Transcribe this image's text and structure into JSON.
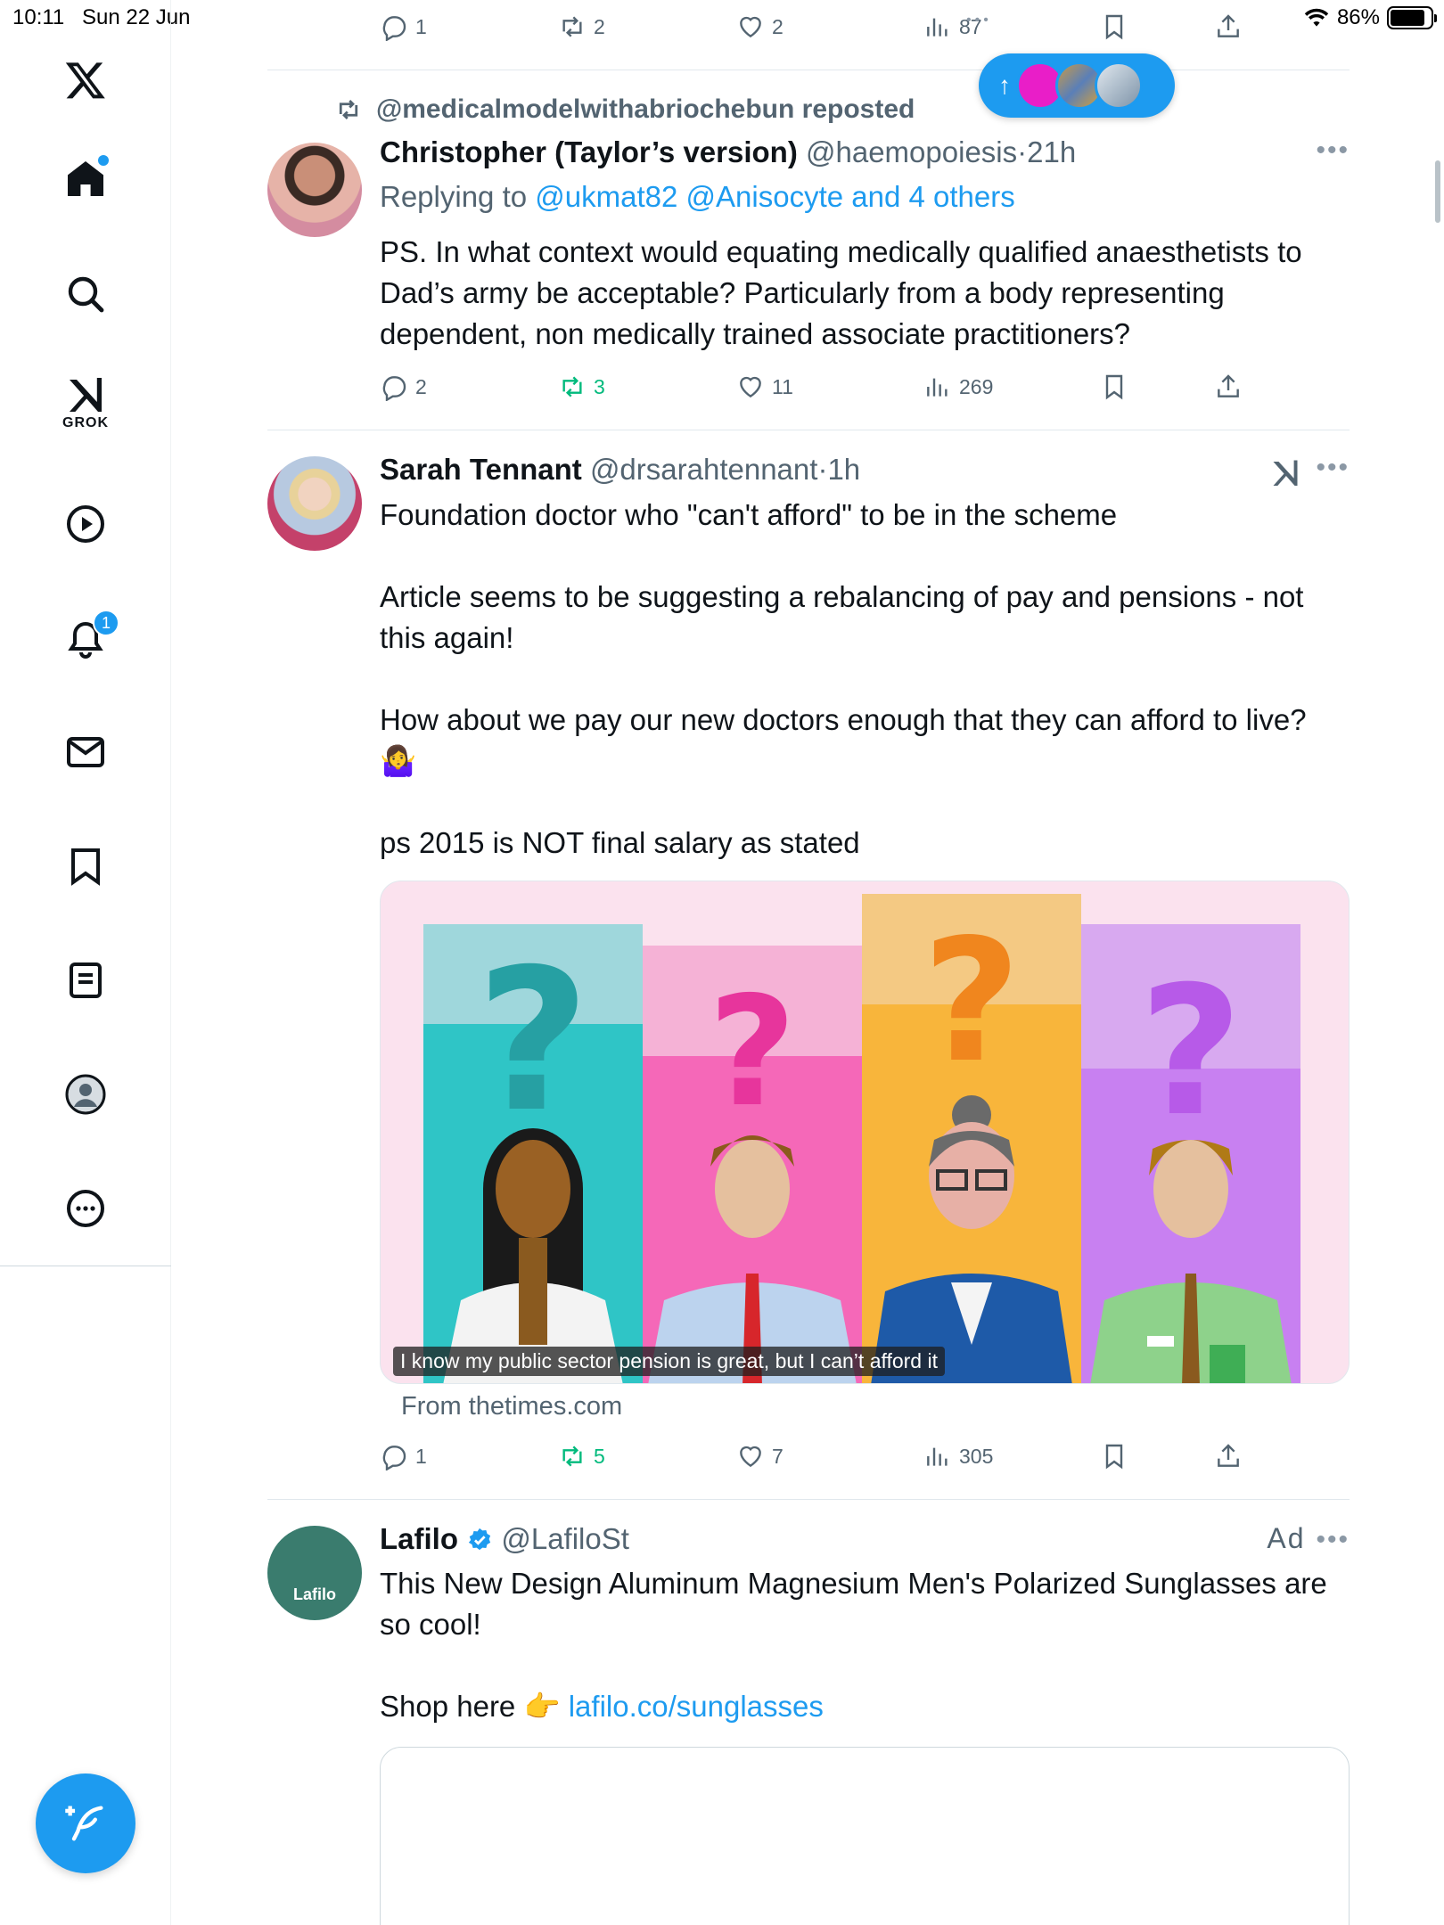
{
  "status_bar": {
    "time": "10:11",
    "date": "Sun 22 Jun",
    "battery": "86%",
    "battery_level": 0.86
  },
  "nav": {
    "items": [
      "X home logo",
      "Home",
      "Search",
      "Grok",
      "Video",
      "Notifications",
      "Messages",
      "Bookmarks",
      "Lists",
      "Profile",
      "More"
    ],
    "grok_label": "GROK",
    "notifications_count": "1"
  },
  "top_actions": {
    "replies": "1",
    "reposts": "2",
    "likes": "2",
    "views": "87"
  },
  "retweet_banner": {
    "text": "@medicalmodelwithabriochebun reposted"
  },
  "tweets": [
    {
      "name": "Christopher (Taylor’s version)",
      "handle": "@haemopoiesis",
      "sep": "·",
      "time": "21h",
      "replying_prefix": "Replying to",
      "replying_to": "@ukmat82 @Anisocyte and 4 others",
      "text": "PS. In what context would equating medically qualified anaesthetists to Dad’s army be acceptable? Particularly from a body representing dependent, non medically trained associate practitioners?",
      "replies": "2",
      "reposts": "3",
      "likes": "11",
      "views": "269"
    },
    {
      "name": "Sarah Tennant",
      "handle": "@drsarahtennant",
      "sep": "·",
      "time": "1h",
      "lines": [
        "Foundation doctor who \"can't afford\" to be in the scheme",
        "",
        "Article seems to be suggesting a rebalancing of pay and pensions - not this again!",
        "",
        "How about we pay our new doctors enough that they can afford to live?",
        "🤷‍♀️",
        "",
        "ps 2015 is NOT final salary as stated"
      ],
      "media_caption": "I know my public sector pension is great, but I can’t afford it",
      "source": "From thetimes.com",
      "replies": "1",
      "reposts": "5",
      "likes": "7",
      "views": "305"
    },
    {
      "name": "Lafilo",
      "handle": "@LafiloSt",
      "ad_label": "Ad",
      "avatar_text": "Lafilo",
      "lines": [
        "This New Design Aluminum Magnesium Men's Polarized Sunglasses are so cool!",
        ""
      ],
      "shop_prefix": "Shop here 👉",
      "link": "lafilo.co/sunglasses"
    }
  ],
  "colors": {
    "accent": "#1d9bf0",
    "repost_green": "#00ba7c",
    "muted": "#536471"
  }
}
